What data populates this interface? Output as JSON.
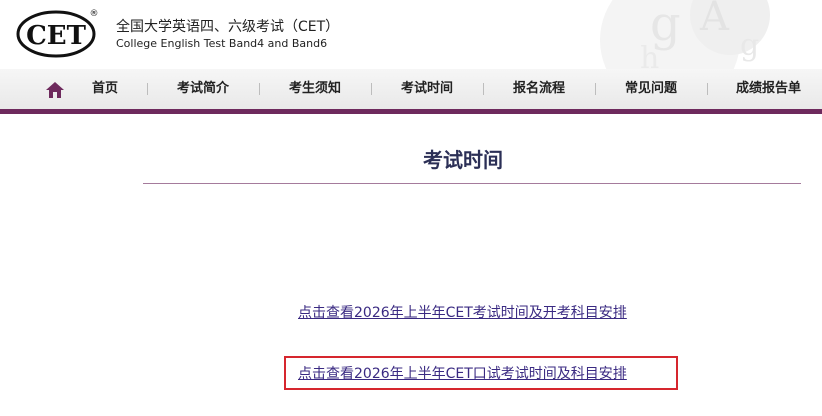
{
  "header": {
    "logo_text": "CET",
    "registered_mark": "®",
    "title_cn": "全国大学英语四、六级考试（CET）",
    "title_en": "College English Test Band4 and Band6"
  },
  "nav": {
    "home_icon": "home-icon",
    "items": [
      {
        "label": "首页"
      },
      {
        "label": "考试简介"
      },
      {
        "label": "考生须知"
      },
      {
        "label": "考试时间"
      },
      {
        "label": "报名流程"
      },
      {
        "label": "常见问题"
      },
      {
        "label": "成绩报告单"
      }
    ]
  },
  "main": {
    "title": "考试时间",
    "links": [
      {
        "label": "点击查看2026年上半年CET考试时间及开考科目安排"
      },
      {
        "label": "点击查看2026年上半年CET口试考试时间及科目安排"
      }
    ]
  },
  "colors": {
    "nav_bar": "#6e2a5d",
    "title": "#2b2f56",
    "link": "#3a2a82",
    "highlight": "#d6262e"
  }
}
